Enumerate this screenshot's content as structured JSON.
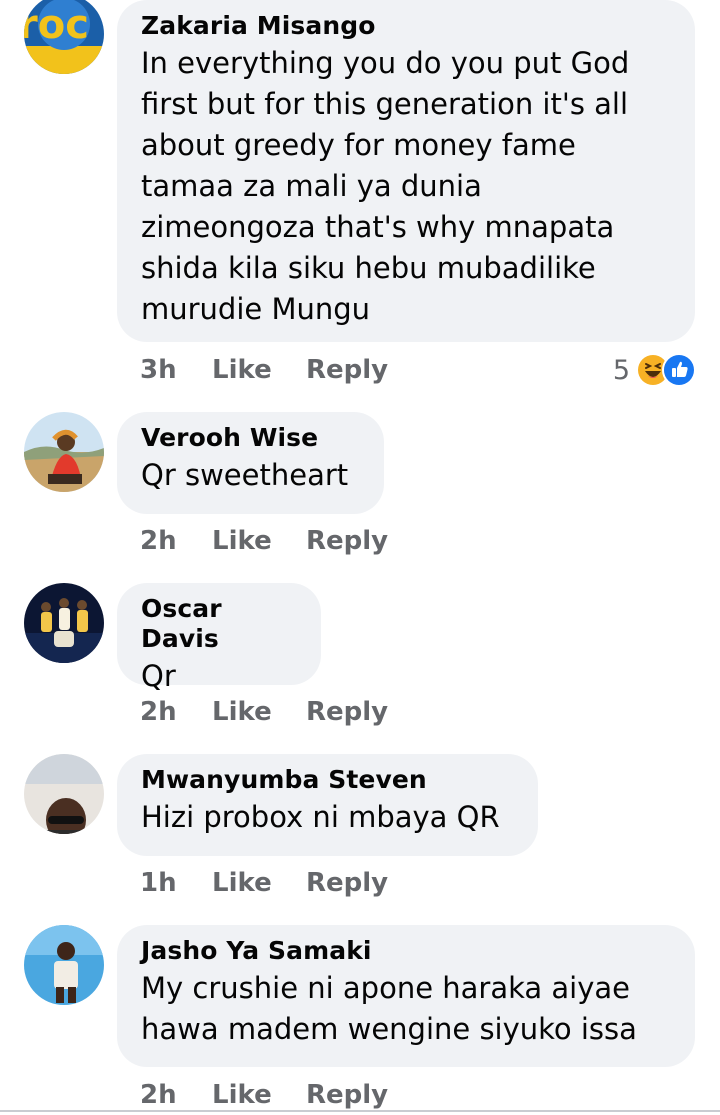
{
  "comments": [
    {
      "author": "Zakaria Misango",
      "text": "In everything you do you put God\nfirst but for this generation it's all\nabout greedy for money fame\ntamaa za mali ya dunia\nzimeongoza that's why mnapata\nshida kila siku hebu mubadilike\nmurudie Mungu",
      "time": "3h",
      "like_label": "Like",
      "reply_label": "Reply",
      "reaction_count": "5",
      "reaction_icons": [
        "haha-icon",
        "like-icon"
      ]
    },
    {
      "author": "Verooh Wise",
      "text": "Qr sweetheart",
      "time": "2h",
      "like_label": "Like",
      "reply_label": "Reply"
    },
    {
      "author": "Oscar Davis",
      "text": "Qr",
      "time": "2h",
      "like_label": "Like",
      "reply_label": "Reply"
    },
    {
      "author": "Mwanyumba Steven",
      "text": "Hizi probox ni mbaya QR",
      "time": "1h",
      "like_label": "Like",
      "reply_label": "Reply"
    },
    {
      "author": "Jasho Ya Samaki",
      "text": "My crushie ni apone haraka aiyae\nhawa madem wengine siyuko issa",
      "time": "2h",
      "like_label": "Like",
      "reply_label": "Reply"
    }
  ],
  "colors": {
    "bubble": "#f0f2f5",
    "meta_text": "#65676b",
    "like_blue": "#1877f2",
    "haha_yellow": "#f7b125"
  }
}
